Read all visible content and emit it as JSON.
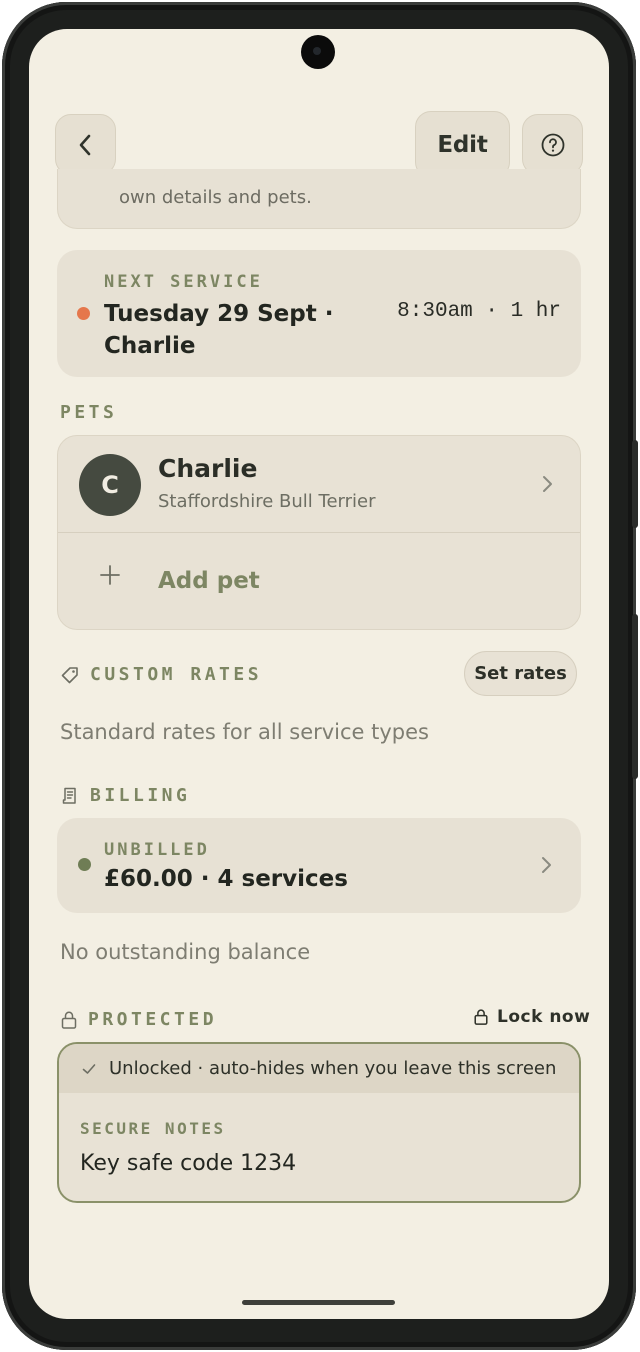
{
  "header": {
    "back_icon": "chevron-left-icon",
    "edit_label": "Edit",
    "help_icon": "question-circle-icon"
  },
  "top_card": {
    "text": "own details and pets."
  },
  "next_service": {
    "eyebrow": "NEXT SERVICE",
    "when_line1": "Tuesday 29 Sept ·",
    "when_line2": "Charlie",
    "time": "8:30am · 1 hr",
    "dot_color": "#e5774c"
  },
  "pets": {
    "section_label": "PETS",
    "items": [
      {
        "initial": "C",
        "name": "Charlie",
        "breed": "Staffordshire Bull Terrier"
      }
    ],
    "add_label": "Add pet"
  },
  "custom_rates": {
    "section_label": "CUSTOM RATES",
    "icon": "tag-icon",
    "button_label": "Set rates",
    "description": "Standard rates for all service types"
  },
  "billing": {
    "section_label": "BILLING",
    "icon": "receipt-icon",
    "eyebrow": "UNBILLED",
    "amount": "£60.00 · 4 services",
    "dot_color": "#6f7d55",
    "balance_text": "No outstanding balance"
  },
  "protected": {
    "section_label": "PROTECTED",
    "icon": "lock-icon",
    "lock_now_label": "Lock now",
    "banner_text": "Unlocked · auto-hides when you leave this screen",
    "notes_label": "SECURE NOTES",
    "notes_value": "Key safe code 1234"
  },
  "colors": {
    "background": "#f3efe3",
    "card": "#e7e1d4",
    "accent_olive": "#7d8663"
  }
}
